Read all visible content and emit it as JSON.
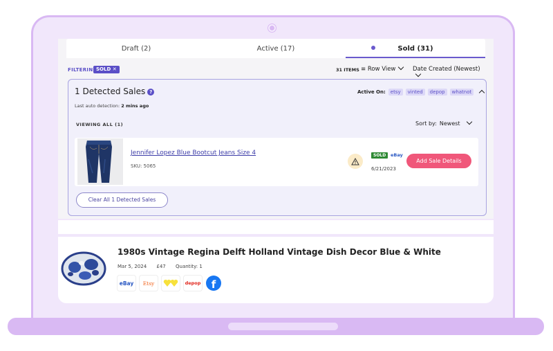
{
  "tabs": [
    {
      "label": "Draft (2)"
    },
    {
      "label": "Active (17)"
    },
    {
      "label": "Sold (31)"
    }
  ],
  "filter": {
    "label": "FILTERING",
    "chip": "SOLD ✕",
    "items_count": "31 ITEMS",
    "view_mode": "≡ Row View",
    "sort_order": "Date Created (Newest)"
  },
  "detected": {
    "title": "1 Detected Sales",
    "help_icon": "?",
    "last_auto_prefix": "Last auto detection:",
    "last_auto_value": "2 mins ago",
    "active_on_label": "Active On:",
    "marketplaces": [
      "etsy",
      "vinted",
      "depop",
      "whatnot"
    ],
    "viewing_all": "VIEWING ALL (1)",
    "sort_by_label": "Sort by:",
    "sort_by_value": "Newest",
    "sale": {
      "title": "Jennifer Lopez Blue Bootcut Jeans Size 4",
      "sku": "SKU: 5065",
      "status": "SOLD",
      "marketplace": "eBay",
      "date": "6/21/2023",
      "action": "Add Sale Details"
    },
    "clear_button": "Clear All 1 Detected Sales"
  },
  "item": {
    "title": "1980s Vintage Regina Delft Holland Vintage Dish Decor Blue & White",
    "date": "Mar 5, 2024",
    "price": "£47",
    "quantity": "Quantity: 1",
    "marketplace_icons": [
      {
        "name": "ebay-logo",
        "text": "eBay",
        "color": "#2b59c3"
      },
      {
        "name": "etsy-logo",
        "text": "Etsy",
        "color": "#f1641e"
      },
      {
        "name": "poshmark-logo",
        "text": "",
        "color": "#f7e13b"
      },
      {
        "name": "depop-logo",
        "text": "depop",
        "color": "#e1251b"
      },
      {
        "name": "facebook-logo",
        "text": "f",
        "color": "#1877f2"
      }
    ]
  },
  "colors": {
    "accent": "#5b4fc7",
    "pink": "#f0577a",
    "frame": "#d9b9f3",
    "sold_green": "#2f8a34"
  }
}
